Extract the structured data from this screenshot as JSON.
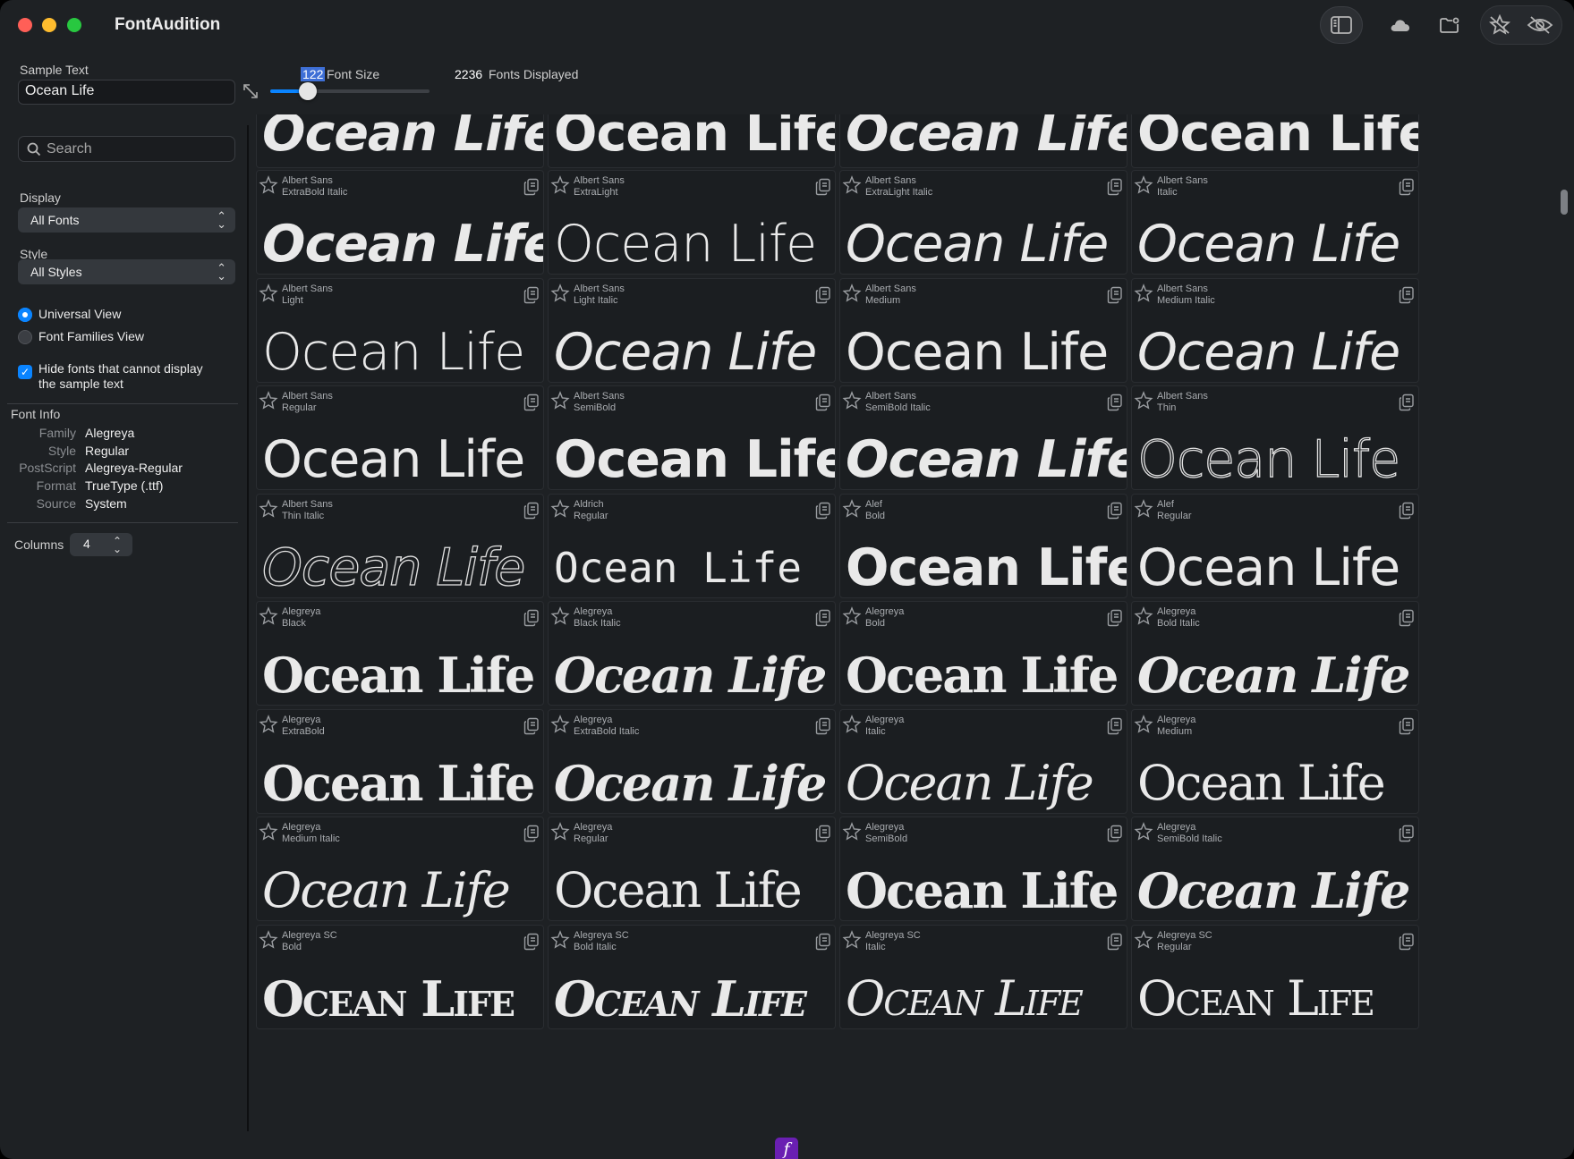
{
  "app": {
    "title": "FontAudition"
  },
  "toolbar": {
    "sidebar_icon": "sidebar-toggle-icon",
    "cloud_icon": "cloud-icon",
    "folder_icon": "folder-badge-icon",
    "star_icon": "favorite-star-icon",
    "eye_icon": "eye-slash-icon"
  },
  "sidebar": {
    "sample_text_label": "Sample Text",
    "sample_text_value": "Ocean Life",
    "search_placeholder": "Search",
    "display_label": "Display",
    "display_value": "All Fonts",
    "style_label": "Style",
    "style_value": "All Styles",
    "view_universal": "Universal View",
    "view_families": "Font Families View",
    "hide_fonts_label": "Hide fonts that cannot display the sample text",
    "font_info_title": "Font Info",
    "font_info": [
      {
        "key": "Family",
        "value": "Alegreya"
      },
      {
        "key": "Style",
        "value": "Regular"
      },
      {
        "key": "PostScript",
        "value": "Alegreya-Regular"
      },
      {
        "key": "Format",
        "value": "TrueType (.ttf)"
      },
      {
        "key": "Source",
        "value": "System"
      }
    ],
    "columns_label": "Columns",
    "columns_value": "4"
  },
  "header": {
    "font_size_value": "122",
    "font_size_label": "Font Size",
    "font_size_fraction": 0.2,
    "fonts_count": "2236",
    "fonts_count_label": "Fonts Displayed"
  },
  "sample": "Ocean Life",
  "fonts": [
    {
      "family": "",
      "style": ""
    },
    {
      "family": "",
      "style": ""
    },
    {
      "family": "",
      "style": ""
    },
    {
      "family": "",
      "style": ""
    },
    {
      "family": "Albert Sans",
      "style": "ExtraBold Italic"
    },
    {
      "family": "Albert Sans",
      "style": "ExtraLight"
    },
    {
      "family": "Albert Sans",
      "style": "ExtraLight Italic"
    },
    {
      "family": "Albert Sans",
      "style": "Italic"
    },
    {
      "family": "Albert Sans",
      "style": "Light"
    },
    {
      "family": "Albert Sans",
      "style": "Light Italic"
    },
    {
      "family": "Albert Sans",
      "style": "Medium"
    },
    {
      "family": "Albert Sans",
      "style": "Medium Italic"
    },
    {
      "family": "Albert Sans",
      "style": "Regular"
    },
    {
      "family": "Albert Sans",
      "style": "SemiBold"
    },
    {
      "family": "Albert Sans",
      "style": "SemiBold Italic"
    },
    {
      "family": "Albert Sans",
      "style": "Thin"
    },
    {
      "family": "Albert Sans",
      "style": "Thin Italic"
    },
    {
      "family": "Aldrich",
      "style": "Regular"
    },
    {
      "family": "Alef",
      "style": "Bold"
    },
    {
      "family": "Alef",
      "style": "Regular"
    },
    {
      "family": "Alegreya",
      "style": "Black"
    },
    {
      "family": "Alegreya",
      "style": "Black Italic"
    },
    {
      "family": "Alegreya",
      "style": "Bold"
    },
    {
      "family": "Alegreya",
      "style": "Bold Italic"
    },
    {
      "family": "Alegreya",
      "style": "ExtraBold"
    },
    {
      "family": "Alegreya",
      "style": "ExtraBold Italic"
    },
    {
      "family": "Alegreya",
      "style": "Italic"
    },
    {
      "family": "Alegreya",
      "style": "Medium"
    },
    {
      "family": "Alegreya",
      "style": "Medium Italic"
    },
    {
      "family": "Alegreya",
      "style": "Regular"
    },
    {
      "family": "Alegreya",
      "style": "SemiBold"
    },
    {
      "family": "Alegreya",
      "style": "SemiBold Italic"
    },
    {
      "family": "Alegreya SC",
      "style": "Bold"
    },
    {
      "family": "Alegreya SC",
      "style": "Bold Italic"
    },
    {
      "family": "Alegreya SC",
      "style": "Italic"
    },
    {
      "family": "Alegreya SC",
      "style": "Regular"
    }
  ],
  "colors": {
    "accent": "#0a84ff",
    "background": "#1e2124",
    "dock_badge": "#6a1fb2"
  },
  "dock_badge_glyph": "f"
}
